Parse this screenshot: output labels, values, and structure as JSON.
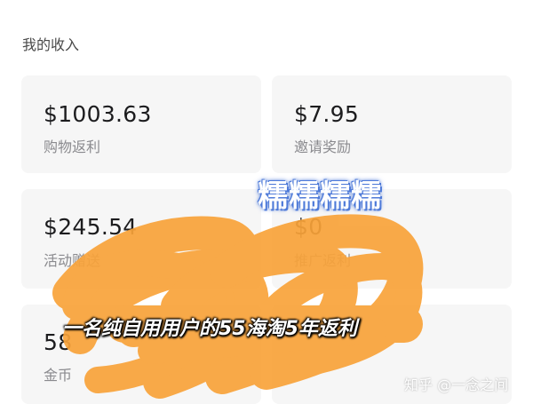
{
  "section": {
    "title": "我的收入"
  },
  "cards": [
    {
      "amount": "$1003.63",
      "label": "购物返利"
    },
    {
      "amount": "$7.95",
      "label": "邀请奖励"
    },
    {
      "amount": "$245.54",
      "label": "活动赠送"
    },
    {
      "amount": "$0",
      "label": "推广返利"
    },
    {
      "amount": "58",
      "label": "金币"
    },
    {
      "amount": "",
      "label": ""
    }
  ],
  "overlay": {
    "watermark_text": "糯糯糯糯",
    "caption": "一名纯自用用户的55海淘5年返利",
    "credit": "知乎 @一念之间",
    "scribble_color": "#f9a33a",
    "watermark_outline_color": "#4f7bd9"
  }
}
